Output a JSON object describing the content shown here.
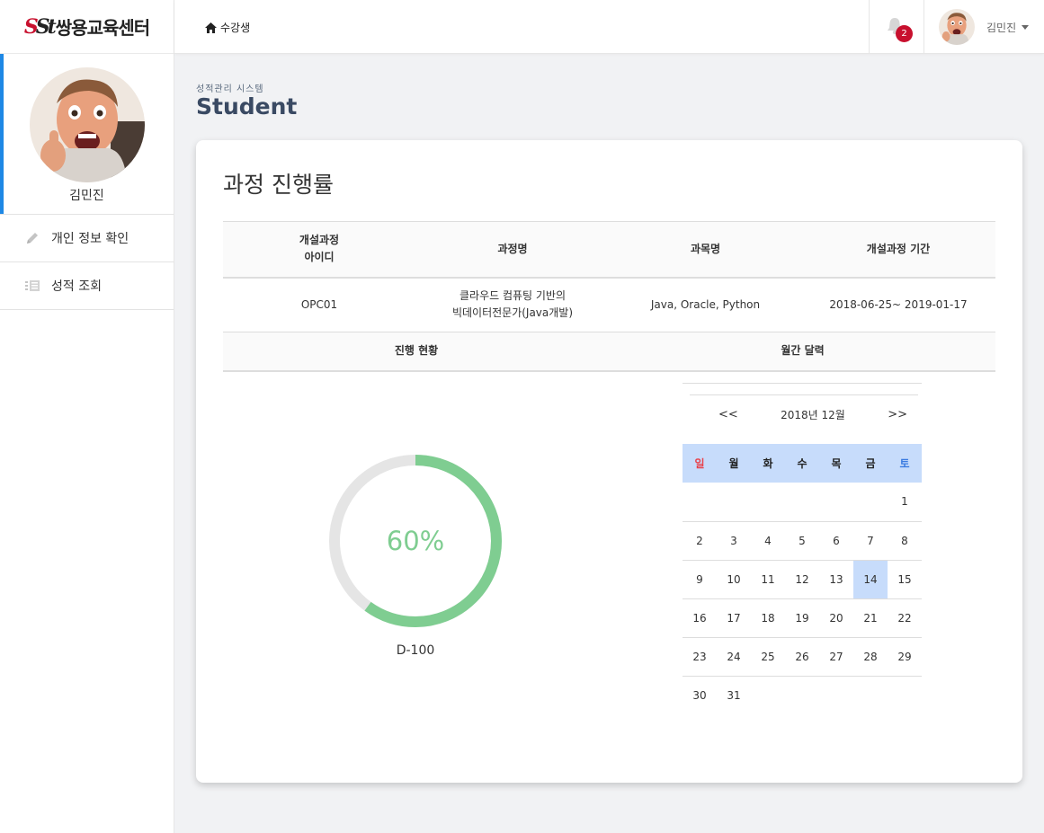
{
  "logo": {
    "mark_s": "S",
    "mark_st": "St",
    "text": "쌍용교육센터"
  },
  "sidebar": {
    "user_name": "김민진",
    "items": [
      {
        "label": "개인 정보 확인",
        "icon": "pencil-icon"
      },
      {
        "label": "성적 조회",
        "icon": "list-icon"
      }
    ]
  },
  "topbar": {
    "breadcrumb": "수강생",
    "notification_count": "2",
    "user_name": "김민진"
  },
  "page": {
    "subtitle": "성적관리 시스템",
    "title": "Student"
  },
  "card": {
    "title": "과정 진행률",
    "table": {
      "headers": [
        "개설과정\n아이디",
        "과정명",
        "과목명",
        "개설과정 기간"
      ],
      "row": [
        "OPC01",
        "클라우드 컴퓨팅 기반의\n빅데이터전문가(Java개발)",
        "Java, Oracle, Python",
        "2018-06-25~ 2019-01-17"
      ],
      "sub_headers": [
        "진행 현황",
        "월간 달력"
      ]
    },
    "progress": {
      "percent": 60,
      "label": "60%",
      "dday": "D-100",
      "color": "#7fcd91",
      "track_color": "#e5e5e5"
    },
    "calendar": {
      "prev": "<<",
      "next": ">>",
      "month_label": "2018년 12월",
      "weekdays": [
        "일",
        "월",
        "화",
        "수",
        "목",
        "금",
        "토"
      ],
      "sunday_color": "#e8424b",
      "saturday_color": "#3b7be0",
      "weeks": [
        [
          "",
          "",
          "",
          "",
          "",
          "",
          "1"
        ],
        [
          "2",
          "3",
          "4",
          "5",
          "6",
          "7",
          "8"
        ],
        [
          "9",
          "10",
          "11",
          "12",
          "13",
          "14",
          "15"
        ],
        [
          "16",
          "17",
          "18",
          "19",
          "20",
          "21",
          "22"
        ],
        [
          "23",
          "24",
          "25",
          "26",
          "27",
          "28",
          "29"
        ],
        [
          "30",
          "31",
          "",
          "",
          "",
          "",
          ""
        ]
      ],
      "today": "14"
    }
  }
}
